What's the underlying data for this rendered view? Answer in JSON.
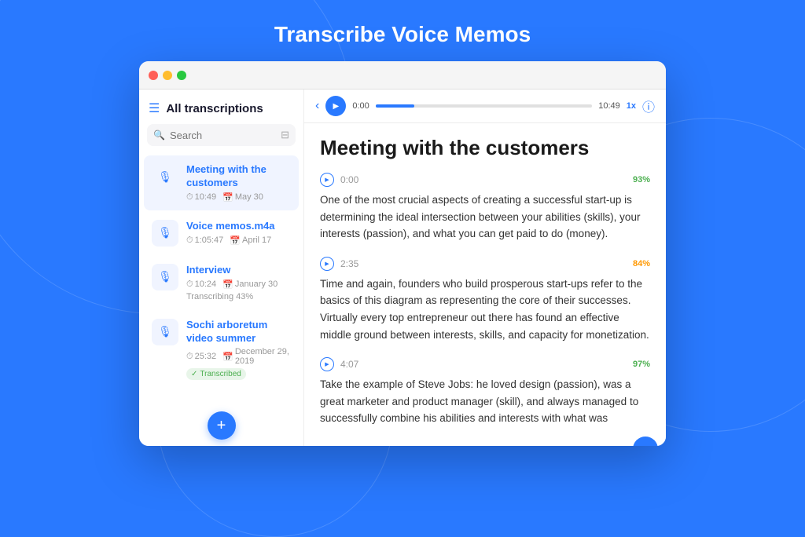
{
  "page": {
    "title": "Transcribe Voice Memos",
    "background_color": "#2979FF"
  },
  "window": {
    "traffic_lights": [
      "red",
      "yellow",
      "green"
    ]
  },
  "sidebar": {
    "title": "All transcriptions",
    "search_placeholder": "Search",
    "items": [
      {
        "id": "meeting",
        "name": "Meeting with the customers",
        "duration": "10:49",
        "date": "May 30",
        "status": "normal",
        "active": true
      },
      {
        "id": "voice",
        "name": "Voice memos.m4a",
        "duration": "1:05:47",
        "date": "April 17",
        "status": "normal",
        "active": false
      },
      {
        "id": "interview",
        "name": "Interview",
        "duration": "10:24",
        "date": "January 30",
        "status": "transcribing",
        "status_text": "Transcribing 43%",
        "active": false
      },
      {
        "id": "sochi",
        "name": "Sochi arboretum video summer",
        "duration": "25:32",
        "date": "December 29, 2019",
        "status": "transcribed",
        "status_text": "Transcribed",
        "active": false
      }
    ],
    "add_button_label": "+"
  },
  "content": {
    "back_icon": "‹",
    "info_icon": "ⓘ",
    "player": {
      "time_start": "0:00",
      "time_end": "10:49",
      "speed": "1x",
      "progress_percent": 18
    },
    "title": "Meeting with the customers",
    "segments": [
      {
        "time": "0:00",
        "confidence": "93%",
        "confidence_class": "conf-green",
        "text": "One of the most crucial aspects of creating a successful start-up is determining the ideal intersection between your abilities (skills), your interests (passion), and what you can get paid to do (money)."
      },
      {
        "time": "2:35",
        "confidence": "84%",
        "confidence_class": "conf-orange",
        "text": "Time and again, founders who build prosperous start-ups refer to the basics of this diagram as representing the core of their successes. Virtually every top entrepreneur out there has found an effective middle ground between interests, skills, and capacity for monetization."
      },
      {
        "time": "4:07",
        "confidence": "97%",
        "confidence_class": "conf-green",
        "text": "Take the example of Steve Jobs: he loved design (passion), was a great marketer and product manager (skill), and always managed to successfully combine his abilities and interests with what was"
      }
    ]
  }
}
